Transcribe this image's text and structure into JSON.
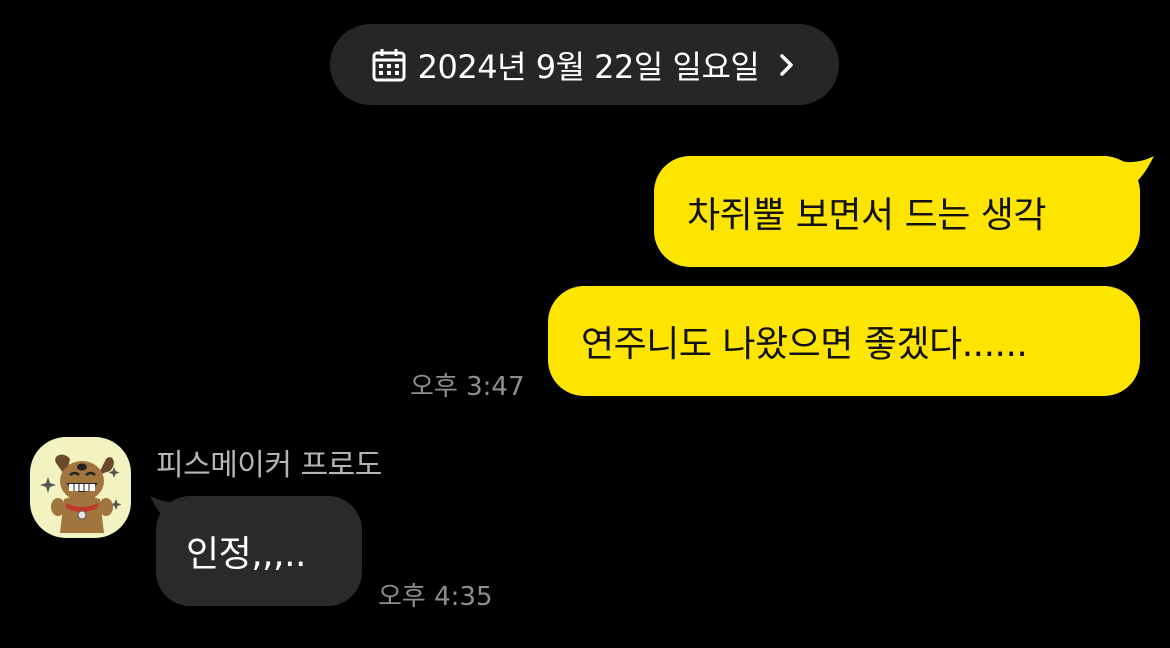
{
  "date_divider": {
    "label": "2024년 9월 22일 일요일",
    "icon": "calendar-icon",
    "chevron": "chevron-right-icon"
  },
  "messages": [
    {
      "sender": "me",
      "text": "차쥐뿔 보면서 드는 생각"
    },
    {
      "sender": "me",
      "text": "연주니도 나왔으면 좋겠다......",
      "time": "오후 3:47"
    },
    {
      "sender": "other",
      "name": "피스메이커 프로도",
      "text": "인정,,,..",
      "time": "오후 4:35"
    }
  ],
  "colors": {
    "background": "#000000",
    "my_bubble": "#FEE500",
    "their_bubble": "#2A2A2A",
    "date_pill": "#262626",
    "time_text": "#8E8E8E",
    "avatar_bg": "#F3F3C2"
  }
}
